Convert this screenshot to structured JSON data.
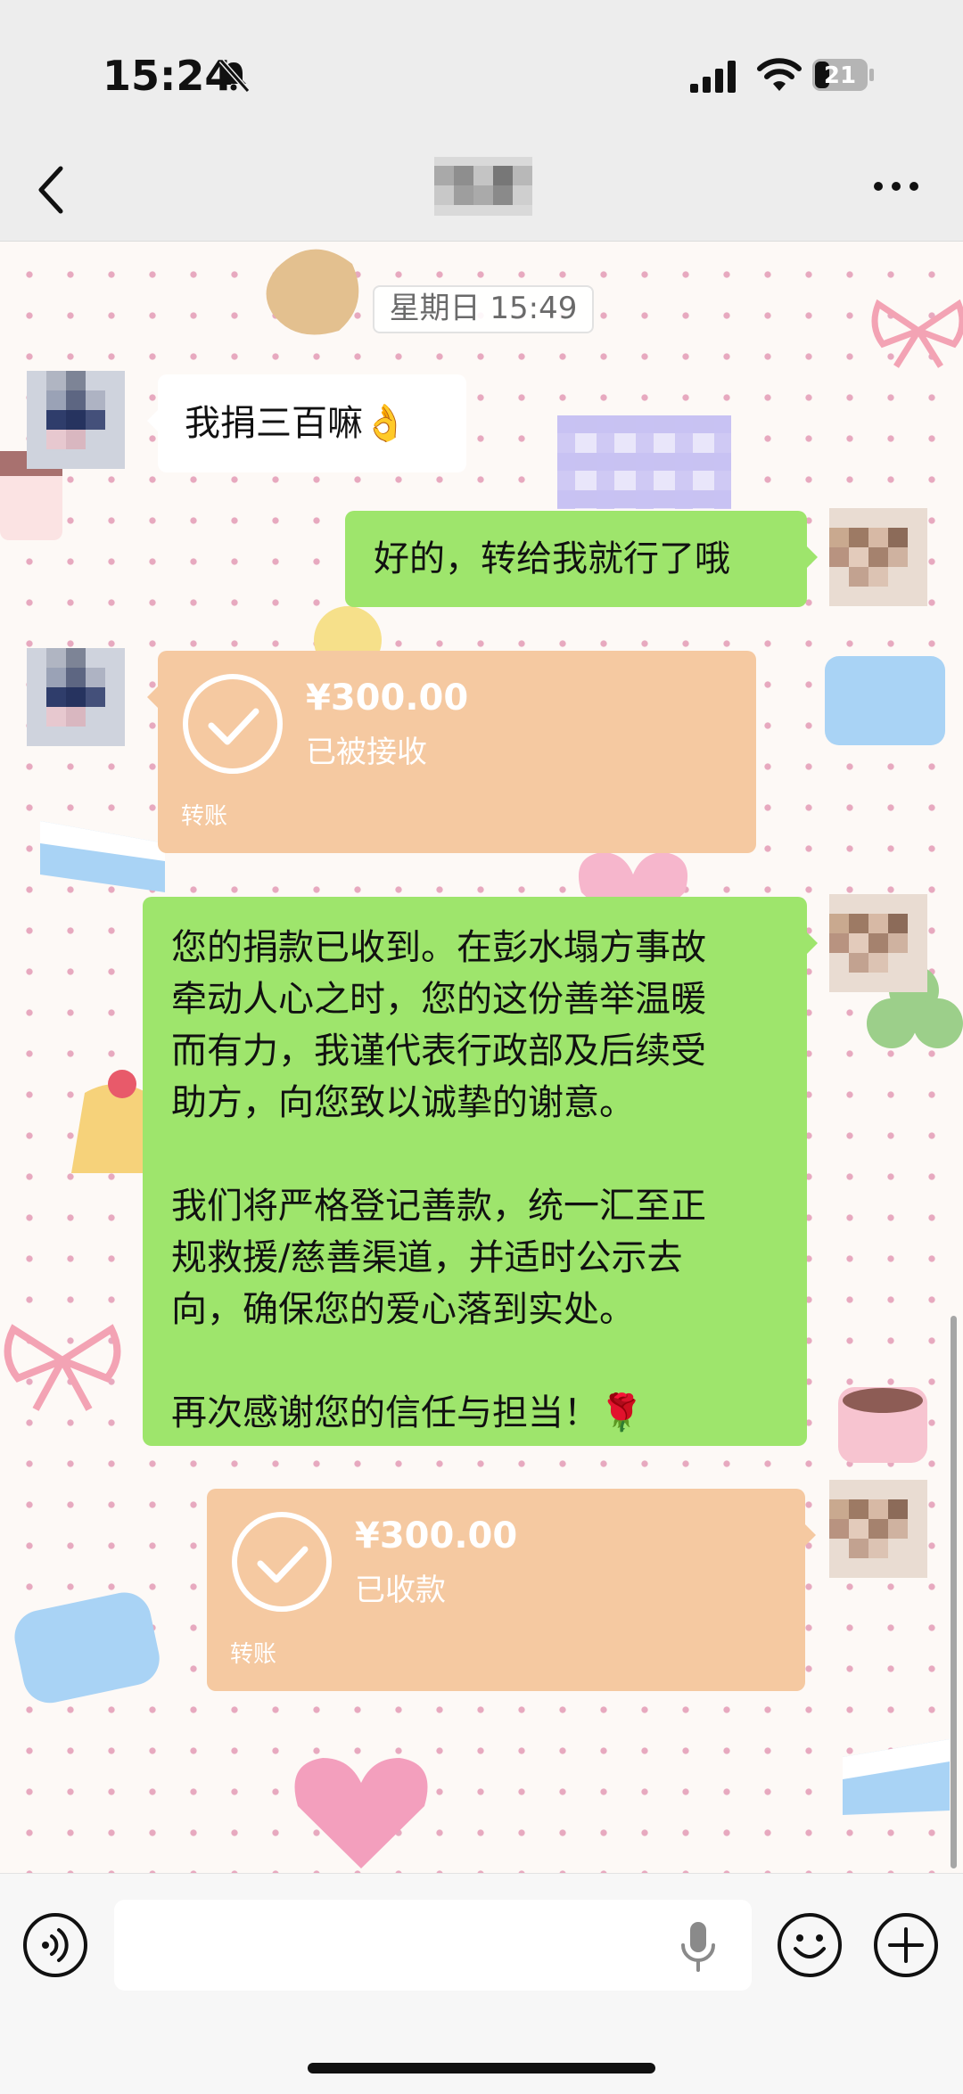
{
  "status_bar": {
    "time": "15:24",
    "battery": "21"
  },
  "chat": {
    "timestamp": "星期日 15:49",
    "messages": {
      "m1": "我捐三百嘛👌",
      "m2": "好的，转给我就行了哦",
      "m4_lines": [
        "您的捐款已收到。在彭水塌方事故",
        "牵动人心之时，您的这份善举温暖",
        "而有力，我谨代表行政部及后续受",
        "助方，向您致以诚挚的谢意。",
        "",
        "我们将严格登记善款，统一汇至正",
        "规救援/慈善渠道，并适时公示去",
        "向，确保您的爱心落到实处。",
        "",
        "再次感谢您的信任与担当！🌹"
      ]
    },
    "transfer_received": {
      "amount": "¥300.00",
      "status": "已被接收",
      "label": "转账"
    },
    "transfer_collected": {
      "amount": "¥300.00",
      "status": "已收款",
      "label": "转账"
    }
  },
  "colors": {
    "green_bubble": "#9ee56c",
    "transfer_card": "#f5c9a1",
    "nav_bg": "#ededed"
  }
}
